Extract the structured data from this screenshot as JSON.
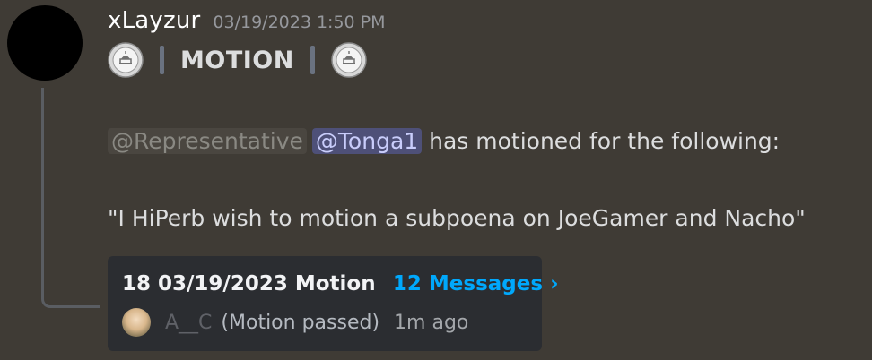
{
  "message": {
    "username": "xLayzur",
    "timestamp": "03/19/2023 1:50 PM",
    "title": "MOTION",
    "role_mention": "@Representative",
    "user_mention": "@Tonga1",
    "body_text": " has motioned for the following:",
    "quote": "\"I HiPerb wish to motion a subpoena on JoeGamer and Nacho\""
  },
  "thread": {
    "name": "18 03/19/2023 Motion",
    "message_count": "12 Messages ›",
    "last_author": "A__C",
    "last_message": "(Motion passed)",
    "last_time": "1m ago"
  },
  "colors": {
    "background": "#3f3b35",
    "link_blue": "#00a8fc",
    "user_mention_bg": "#4e5078"
  }
}
